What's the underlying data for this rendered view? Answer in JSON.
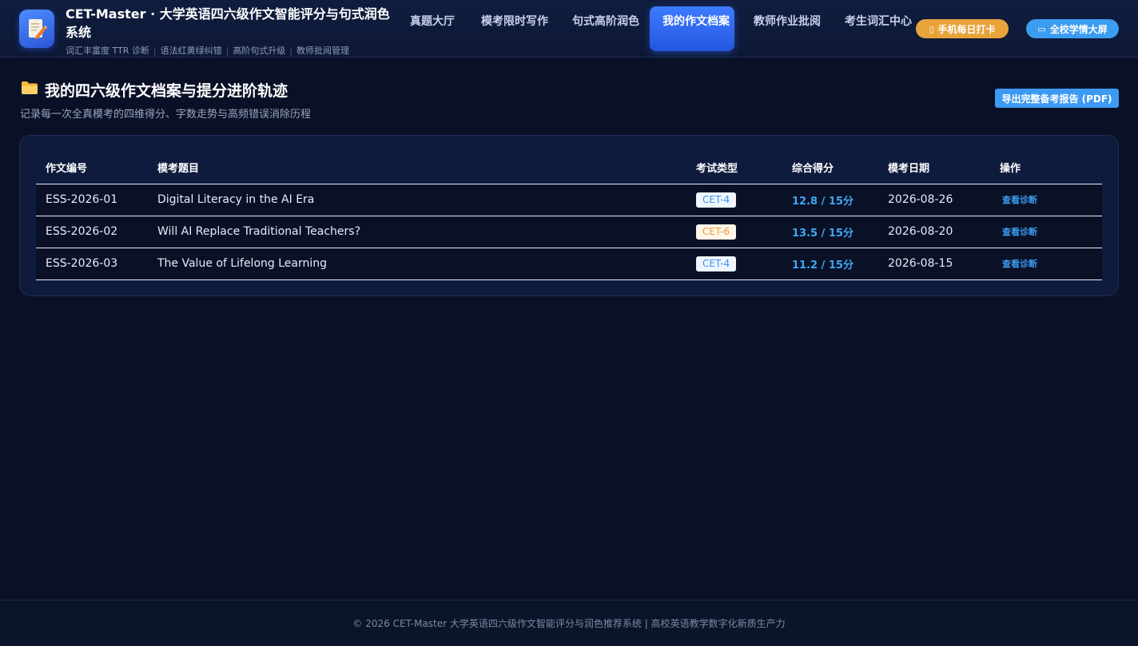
{
  "header": {
    "app_title": "CET-Master · 大学英语四六级作文智能评分与句式润色系统",
    "sub_features": [
      "词汇丰富度 TTR 诊断",
      "语法红黄绿纠错",
      "高阶句式升级",
      "教师批阅管理"
    ],
    "nav": [
      {
        "label": "真题大厅",
        "active": false
      },
      {
        "label": "模考限时写作",
        "active": false
      },
      {
        "label": "句式高阶润色",
        "active": false
      },
      {
        "label": "我的作文档案",
        "active": true
      },
      {
        "label": "教师作业批阅",
        "active": false
      },
      {
        "label": "考生词汇中心",
        "active": false
      }
    ],
    "checkin_label": "手机每日打卡",
    "bigscreen_label": "全校学情大屏"
  },
  "page": {
    "title": "我的四六级作文档案与提分进阶轨迹",
    "subtitle": "记录每一次全真模考的四维得分、字数走势与高频错误消除历程",
    "export_label": "导出完整备考报告 (PDF)"
  },
  "table": {
    "columns": [
      "作文编号",
      "模考题目",
      "考试类型",
      "综合得分",
      "模考日期",
      "操作"
    ],
    "rows": [
      {
        "id": "ESS-2026-01",
        "topic": "Digital Literacy in the AI Era",
        "type": "CET-4",
        "score": "12.8 / 15分",
        "date": "2026-08-26",
        "action": "查看诊断"
      },
      {
        "id": "ESS-2026-02",
        "topic": "Will AI Replace Traditional Teachers?",
        "type": "CET-6",
        "score": "13.5 / 15分",
        "date": "2026-08-20",
        "action": "查看诊断"
      },
      {
        "id": "ESS-2026-03",
        "topic": "The Value of Lifelong Learning",
        "type": "CET-4",
        "score": "11.2 / 15分",
        "date": "2026-08-15",
        "action": "查看诊断"
      }
    ]
  },
  "footer": {
    "text": "© 2026 CET-Master 大学英语四六级作文智能评分与润色推荐系统 | 高校英语教学数字化新质生产力"
  },
  "colors": {
    "background": "#0a1126",
    "accent": "#3d7bff",
    "cet4": "#3a94e8",
    "cet6": "#ef9a34",
    "score": "#3ca9f5"
  },
  "icons": {
    "logo": "document-pen-icon",
    "checkin": "phone-icon",
    "bigscreen": "monitor-icon",
    "title": "folder-icon"
  }
}
